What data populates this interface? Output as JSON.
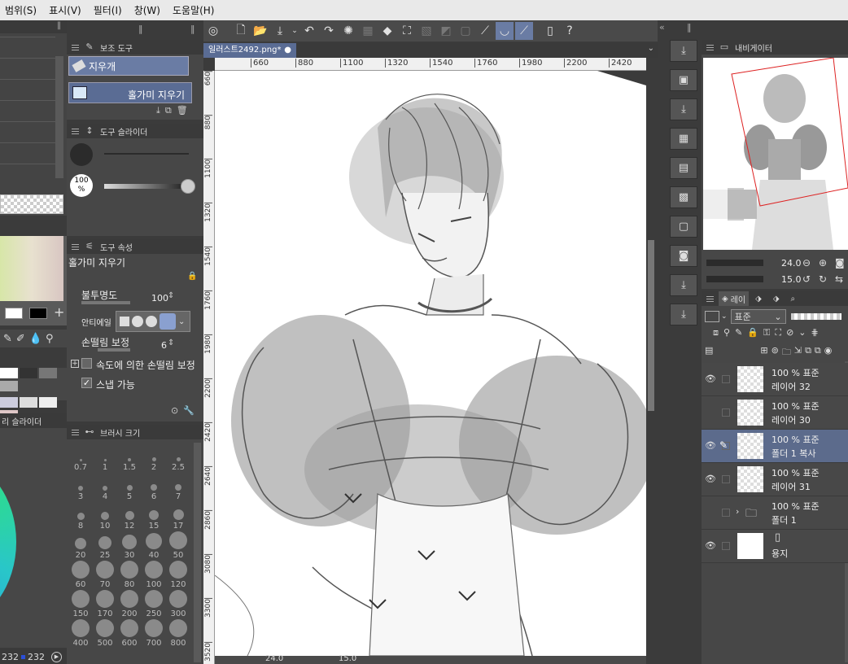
{
  "menu": {
    "items": [
      "범위(S)",
      "표시(V)",
      "필터(I)",
      "창(W)",
      "도움말(H)"
    ]
  },
  "aux_tool": {
    "title": "보조 도구",
    "items": [
      "지우개",
      "홀가미 지우기"
    ]
  },
  "tool_slider": {
    "title": "도구 슬라이더",
    "percent": "100\n%"
  },
  "tool_props": {
    "title": "도구 속성",
    "tool_name": "홀가미 지우기",
    "opacity_label": "불투명도",
    "opacity_value": "100",
    "antialias_label": "안티에일",
    "stabilize_label": "손떨림 보정",
    "stabilize_value": "6",
    "speed_label": "속도에 의한 손떨림 보정",
    "snap_label": "스냅 가능"
  },
  "color_slider": {
    "title": "리 슬라이더"
  },
  "brush_size": {
    "title": "브러시 크기",
    "sizes": [
      "0.7",
      "1",
      "1.5",
      "2",
      "2.5",
      "3",
      "4",
      "5",
      "6",
      "7",
      "8",
      "10",
      "12",
      "15",
      "17",
      "20",
      "25",
      "30",
      "40",
      "50",
      "60",
      "70",
      "80",
      "100",
      "120",
      "150",
      "170",
      "200",
      "250",
      "300",
      "400",
      "500",
      "600",
      "700",
      "800"
    ]
  },
  "color_values": {
    "a": "232",
    "b": "232"
  },
  "canvas_tab": {
    "title": "일러스트2492.png*"
  },
  "ruler": {
    "h": [
      "660",
      "880",
      "1100",
      "1320",
      "1540",
      "1760",
      "1980",
      "2200",
      "2420"
    ],
    "v": [
      "660",
      "880",
      "1100",
      "1320",
      "1540",
      "1760",
      "1980",
      "2200",
      "2420",
      "2640",
      "2860",
      "3080",
      "3300",
      "3520"
    ]
  },
  "status": {
    "zoom": "24.0",
    "angle": "15.0"
  },
  "navigator": {
    "title": "내비게이터",
    "zoom": "24.0",
    "angle": "15.0"
  },
  "layers_panel": {
    "tab": "레이",
    "blend_mode": "표준",
    "layers": [
      {
        "pct": "100 % 표준",
        "name": "레이어 32",
        "eye": true,
        "selected": false,
        "type": "raster"
      },
      {
        "pct": "100 % 표준",
        "name": "레이어 30",
        "eye": false,
        "selected": false,
        "type": "raster"
      },
      {
        "pct": "100 % 표준",
        "name": "폴더 1 복사",
        "eye": true,
        "selected": true,
        "type": "raster"
      },
      {
        "pct": "100 % 표준",
        "name": "레이어 31",
        "eye": true,
        "selected": false,
        "type": "raster"
      },
      {
        "pct": "100 % 표준",
        "name": "폴더 1",
        "eye": false,
        "selected": false,
        "type": "folder"
      },
      {
        "pct": "",
        "name": "용지",
        "eye": true,
        "selected": false,
        "type": "paper"
      }
    ]
  },
  "colors": {
    "accent": "#5a6c94",
    "panel": "#474747",
    "dark": "#3a3a3a"
  }
}
